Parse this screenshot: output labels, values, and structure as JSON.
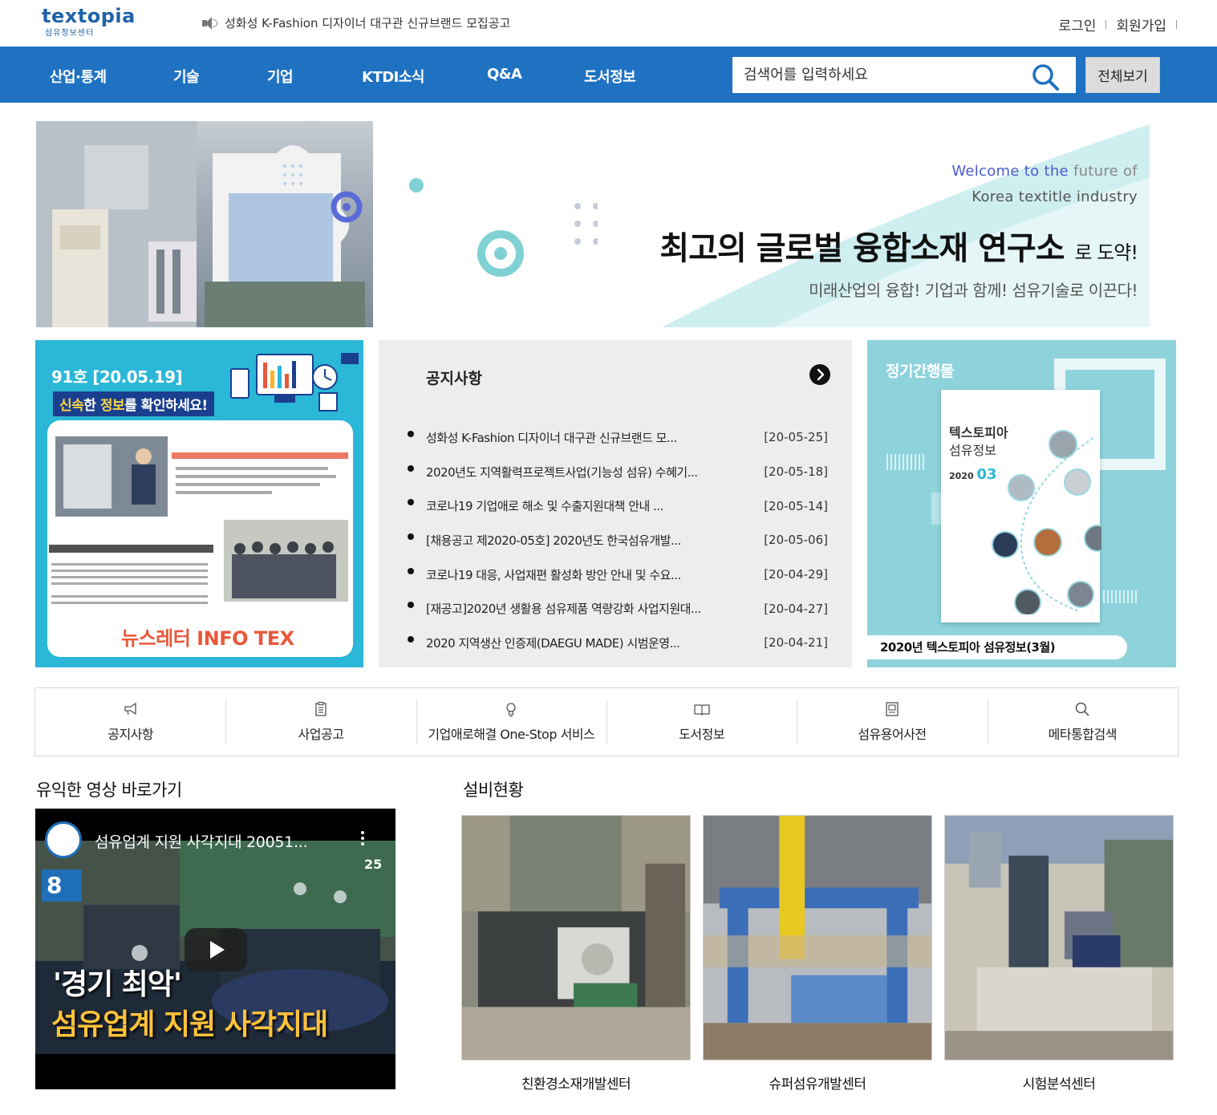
{
  "header": {
    "logo_text": "textopia",
    "logo_sub": "섬유정보센터",
    "ticker": "성화성 K-Fashion 디자이너 대구관 신규브랜드 모집공고",
    "login": "로그인",
    "signup": "회원가입"
  },
  "nav": {
    "items": [
      "산업·통계",
      "기술",
      "기업",
      "KTDI소식",
      "Q&A",
      "도서정보"
    ],
    "search_placeholder": "검색어를 입력하세요",
    "view_all": "전체보기"
  },
  "hero": {
    "welcome_a": "Welcome to the",
    "welcome_b": "future of",
    "korea": "Korea textitle industry",
    "main": "최고의 글로벌 융합소재 연구소",
    "main_suffix": "로 도약!",
    "sub": "미래산업의 융합! 기업과 함께! 섬유기술로 이끈다!"
  },
  "newsletter": {
    "issue": "91호 [20.05.19]",
    "check_a": "신속",
    "check_b": "한 ",
    "check_c": "정보",
    "check_d": "를 확인하세요!",
    "footer": "뉴스레터 INFO TEX"
  },
  "notices": {
    "title": "공지사항",
    "items": [
      {
        "title": "성화성 K-Fashion 디자이너 대구관 신규브랜드 모...",
        "date": "[20-05-25]"
      },
      {
        "title": "2020년도 지역활력프로젝트사업(기능성 섬유) 수혜기...",
        "date": "[20-05-18]"
      },
      {
        "title": "코로나19 기업애로 해소 및 수출지원대책 안내 ...",
        "date": "[20-05-14]"
      },
      {
        "title": "[채용공고 제2020-05호] 2020년도 한국섬유개발...",
        "date": "[20-05-06]"
      },
      {
        "title": "코로나19 대응, 사업재편 활성화 방안 안내 및 수요...",
        "date": "[20-04-29]"
      },
      {
        "title": "[재공고]2020년 생활용 섬유제품 역량강화 사업지원대...",
        "date": "[20-04-27]"
      },
      {
        "title": "2020 지역생산 인증제(DAEGU MADE) 시범운영...",
        "date": "[20-04-21]"
      }
    ]
  },
  "periodical": {
    "title": "정기간행물",
    "book_title": "텍스토피아",
    "book_sub": "섬유정보",
    "book_year": "2020",
    "book_month": "03",
    "caption": "2020년 텍스토피아 섬유정보(3월)"
  },
  "quick_links": [
    {
      "label": "공지사항",
      "icon": "megaphone-icon"
    },
    {
      "label": "사업공고",
      "icon": "clipboard-icon"
    },
    {
      "label": "기업애로해결 One-Stop 서비스",
      "icon": "lightbulb-icon"
    },
    {
      "label": "도서정보",
      "icon": "book-icon"
    },
    {
      "label": "섬유용어사전",
      "icon": "dictionary-icon"
    },
    {
      "label": "메타통합검색",
      "icon": "search-icon"
    }
  ],
  "video_section": {
    "title": "유익한 영상 바로가기",
    "video_title": "섬유업계 지원 사각지대 20051...",
    "caption1": "'경기 최악'",
    "caption2": "섬유업계 지원 사각지대",
    "badge": "8",
    "anniv": "25"
  },
  "facility_section": {
    "title": "설비현황",
    "items": [
      {
        "label": "친환경소재개발센터"
      },
      {
        "label": "슈퍼섬유개발센터"
      },
      {
        "label": "시험분석센터"
      }
    ]
  },
  "colors": {
    "brand_blue": "#1f72c2",
    "newsletter_bg": "#2bb7d7",
    "periodical_bg": "#8ed3dc",
    "notice_bg": "#ededed"
  }
}
